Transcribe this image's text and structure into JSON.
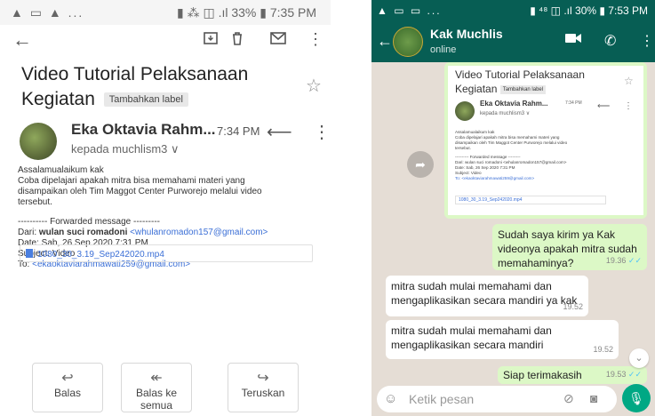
{
  "left": {
    "status": {
      "left": "▲ ▭ ▲ ...",
      "right": "▮ ⁂ ◫ .ıl 33% ▮ 7:35 PM"
    },
    "toolbar": {
      "back": "←",
      "archive": "⊡",
      "delete": "🗑",
      "mail": "✉",
      "more": "⋮"
    },
    "subject": "Video Tutorial Pelaksanaan Kegiatan",
    "label_tag": "Tambahkan label",
    "sender": "Eka Oktavia Rahm...",
    "time": "7:34 PM",
    "recipient": "kepada muchlism3 ∨",
    "body": {
      "greeting": "Assalamualaikum kak",
      "line1": "Coba dipelajari apakah mitra bisa memahami materi yang",
      "line2": "disampaikan oleh Tim Maggot Center Purworejo melalui video",
      "line3": "tersebut.",
      "fwd_header": "---------- Forwarded message ---------",
      "from_label": "Dari: ",
      "from_name": "wulan suci romadoni",
      "from_email": "<whulanromadon157@gmail.com>",
      "date": "Date: Sab, 26 Sep 2020 7:31 PM",
      "subject": "Subject: Video",
      "to_label": "To: ",
      "to_email": "<ekaoktaviarahmawati259@gmail.com>"
    },
    "attachment": "1080_30_3.19_Sep242020.mp4",
    "actions": [
      {
        "icon": "↩",
        "label": "Balas"
      },
      {
        "icon": "↞",
        "label": "Balas ke semua"
      },
      {
        "icon": "↪",
        "label": "Teruskan"
      }
    ]
  },
  "right": {
    "status": {
      "left": "▲ ▭ ▭ ...",
      "right": "▮ ⁴⁸ ◫ .ıl 30% ▮ 7:53 PM"
    },
    "contact": {
      "name": "Kak Muchlis",
      "presence": "online"
    },
    "forward_screenshot": {
      "subject": "Video Tutorial Pelaksanaan Kegiatan",
      "tag": "Tambahkan label",
      "sender": "Eka Oktavia Rahm...",
      "time": "7:34 PM",
      "recipient": "kepada muchlism3 ∨",
      "greeting": "Assalamualaikum kak",
      "line1": "Coba dipelajari apakah mitra bisa memahami materi yang",
      "line2": "disampaikan oleh Tim Maggot Center Purworejo melalui video",
      "line3": "tersebut.",
      "fwd_header": "---------- Forwarded message ---------",
      "from": "Dari: wulan suci romadoni <whulanromadon157@gmail.com>",
      "date": "Date: Sab, 26 Sep 2020 7:31 PM",
      "subject_line": "Subject: Video",
      "to": "To: <ekaoktaviarahmawati259@gmail.com>",
      "attachment": "1080_30_3.19_Sep242020.mp4"
    },
    "messages": [
      {
        "dir": "out",
        "text": "Sudah saya kirim ya Kak videonya apakah mitra sudah memahaminya?",
        "time": "19.36",
        "ticks": "✓✓"
      },
      {
        "dir": "in",
        "text": "mitra sudah mulai memahami dan mengaplikasikan secara mandiri ya kak",
        "time": "19.52"
      },
      {
        "dir": "in",
        "text": "mitra sudah mulai memahami dan mengaplikasikan secara mandiri",
        "time": "19.52"
      },
      {
        "dir": "out",
        "text": "Siap terimakasih",
        "time": "19.53",
        "ticks": "✓✓"
      }
    ],
    "input_placeholder": "Ketik pesan"
  },
  "colors": {
    "whatsapp_header": "#075e54",
    "outgoing_bubble": "#dcf8c6",
    "chat_bg": "#e5ddd5",
    "link": "#3b6fd6"
  }
}
